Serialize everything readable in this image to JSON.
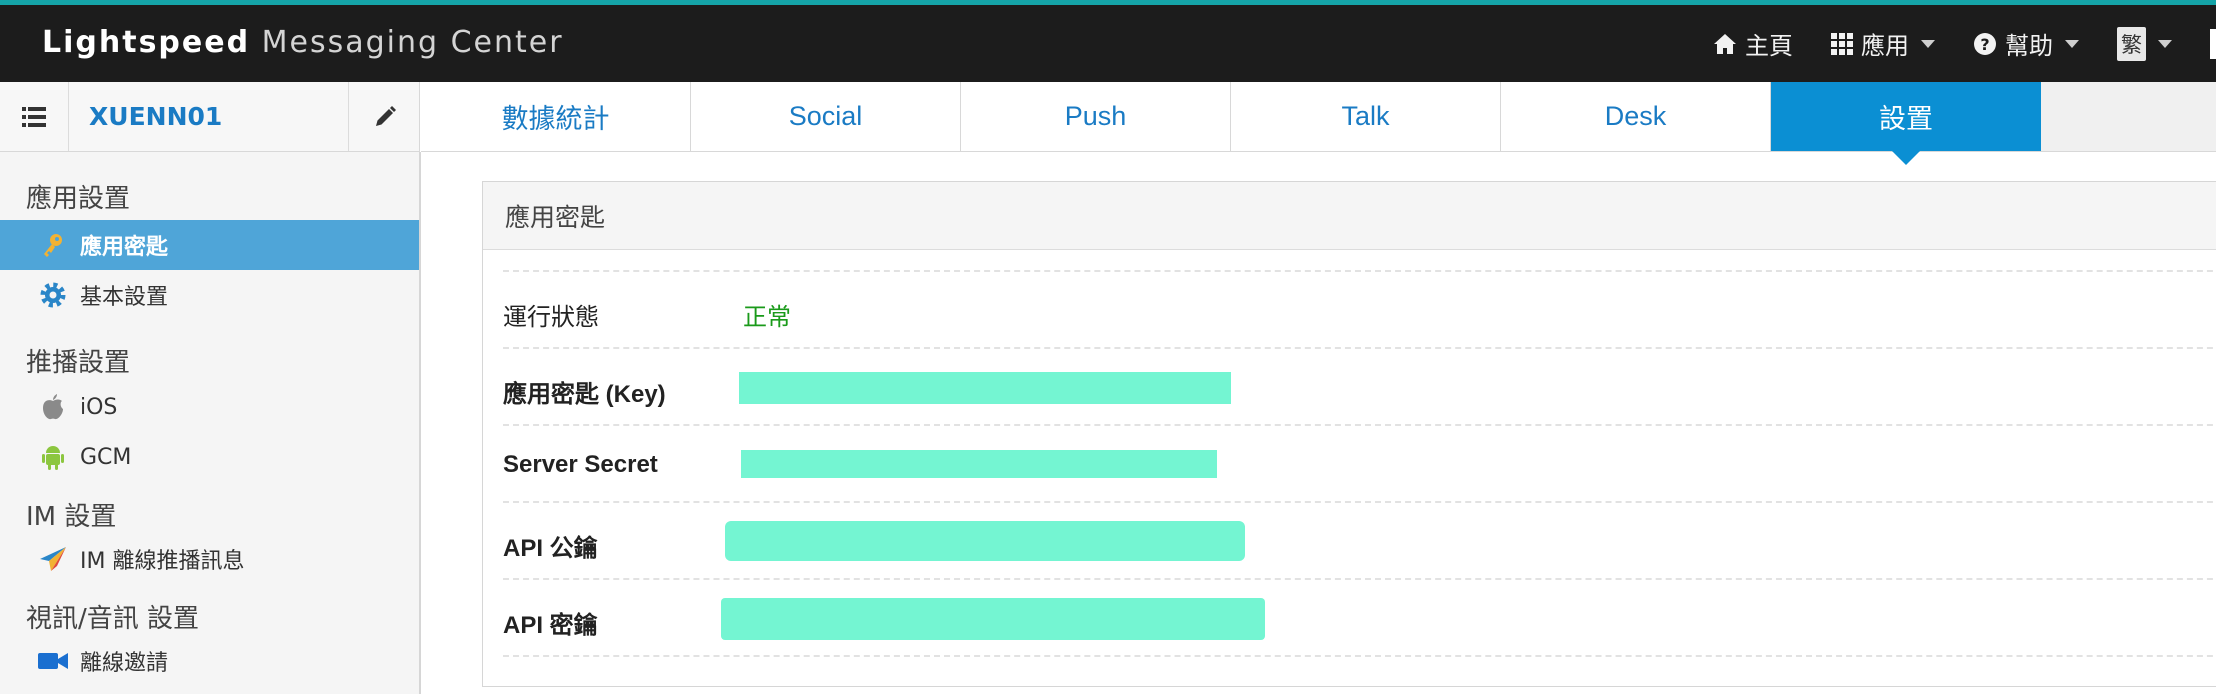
{
  "brand": {
    "name_bold": "Lightspeed",
    "name_rest": "Messaging Center"
  },
  "topnav": {
    "home_label": "主頁",
    "apps_label": "應用",
    "help_label": "幫助",
    "language_label": "繁"
  },
  "app": {
    "name": "XUENN01"
  },
  "tabs": [
    {
      "label": "數據統計"
    },
    {
      "label": "Social"
    },
    {
      "label": "Push"
    },
    {
      "label": "Talk"
    },
    {
      "label": "Desk"
    },
    {
      "label": "設置",
      "active": true
    }
  ],
  "sidebar": {
    "sections": [
      {
        "title": "應用設置",
        "items": [
          {
            "label": "應用密匙",
            "icon": "key-icon",
            "active": true
          },
          {
            "label": "基本設置",
            "icon": "gear-icon"
          }
        ]
      },
      {
        "title": "推播設置",
        "items": [
          {
            "label": "iOS",
            "icon": "apple-icon"
          },
          {
            "label": "GCM",
            "icon": "android-icon"
          }
        ]
      },
      {
        "title": "IM 設置",
        "items": [
          {
            "label": "IM 離線推播訊息",
            "icon": "paper-plane-icon"
          }
        ]
      },
      {
        "title": "視訊/音訊 設置",
        "items": [
          {
            "label": "離線邀請",
            "icon": "video-camera-icon"
          }
        ]
      }
    ]
  },
  "panel": {
    "title": "應用密匙",
    "rows": [
      {
        "label": "運行狀態",
        "value": "正常"
      },
      {
        "label": "應用密匙 (Key)",
        "value": ""
      },
      {
        "label": "Server Secret",
        "value": ""
      },
      {
        "label": "API 公鑰",
        "value": ""
      },
      {
        "label": "API 密鑰",
        "value": ""
      }
    ]
  },
  "colors": {
    "accent": "#0b8fd3",
    "sidebar_active": "#4fa5d8",
    "status_ok": "#1a9a1a",
    "redaction": "#74f5d2",
    "topbar": "#1c1c1c"
  }
}
